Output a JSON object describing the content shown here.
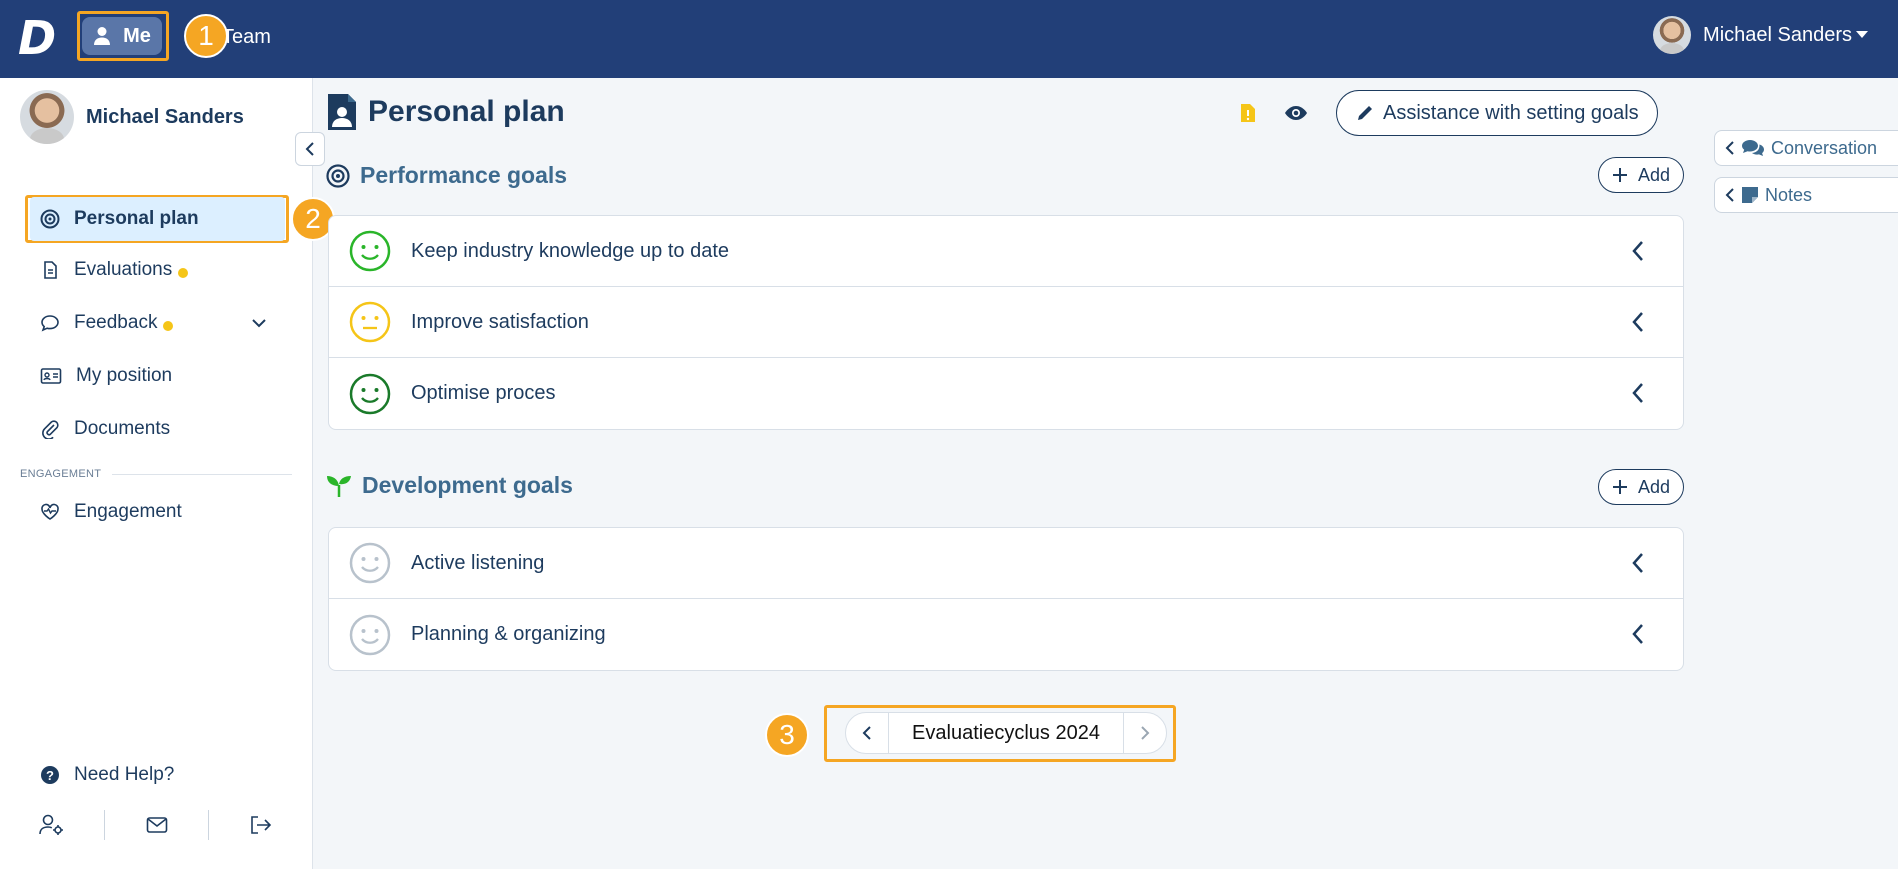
{
  "topbar": {
    "logo": "D",
    "me_label": "Me",
    "team_label": "Team",
    "user_name": "Michael Sanders"
  },
  "badges": [
    "1",
    "2",
    "3"
  ],
  "sidebar": {
    "profile_name": "Michael Sanders",
    "items": [
      {
        "label": "Personal plan",
        "icon": "target-icon",
        "active": true
      },
      {
        "label": "Evaluations",
        "icon": "document-icon",
        "dot": true
      },
      {
        "label": "Feedback",
        "icon": "chat-icon",
        "dot": true,
        "expandable": true
      },
      {
        "label": "My position",
        "icon": "id-card-icon"
      },
      {
        "label": "Documents",
        "icon": "paperclip-icon"
      }
    ],
    "section_label": "ENGAGEMENT",
    "engagement_label": "Engagement",
    "help_label": "Need Help?"
  },
  "main": {
    "title": "Personal plan",
    "assist_label": "Assistance with setting goals",
    "performance": {
      "heading": "Performance goals",
      "add_label": "Add",
      "goals": [
        {
          "label": "Keep industry knowledge up to date",
          "mood": "happy",
          "color": "#2ab52a"
        },
        {
          "label": "Improve satisfaction",
          "mood": "neutral",
          "color": "#f5c518"
        },
        {
          "label": "Optimise proces",
          "mood": "happy",
          "color": "#1a7a2a"
        }
      ]
    },
    "development": {
      "heading": "Development goals",
      "add_label": "Add",
      "goals": [
        {
          "label": "Active listening",
          "mood": "happy",
          "color": "#b8c2cc"
        },
        {
          "label": "Planning & organizing",
          "mood": "happy",
          "color": "#b8c2cc"
        }
      ]
    },
    "cycle_label": "Evaluatiecyclus 2024"
  },
  "right_tabs": {
    "conversation": "Conversation",
    "notes": "Notes"
  },
  "colors": {
    "topbar": "#223f78",
    "highlight": "#f5a623",
    "text": "#1d3b5e",
    "dot": "#f5c518"
  }
}
